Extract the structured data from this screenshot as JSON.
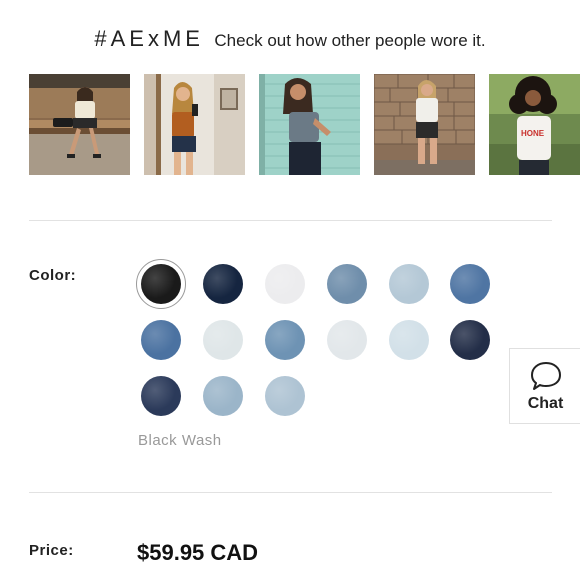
{
  "header": {
    "hashtag": "#AExME",
    "tagline": "Check out how other people wore it."
  },
  "gallery": {
    "photos": [
      {
        "name": "gallery-photo-1"
      },
      {
        "name": "gallery-photo-2"
      },
      {
        "name": "gallery-photo-3"
      },
      {
        "name": "gallery-photo-4"
      },
      {
        "name": "gallery-photo-5",
        "shirt_text": "HONE"
      }
    ]
  },
  "color_section": {
    "label": "Color:",
    "selected_name": "Black Wash",
    "selected_index": 0,
    "swatches": [
      {
        "color": "#1a1a1a"
      },
      {
        "color": "#152540"
      },
      {
        "color": "#ececee"
      },
      {
        "color": "#6f8eab"
      },
      {
        "color": "#b4c8d6"
      },
      {
        "color": "#4f75a3"
      },
      {
        "color": "#4b72a1"
      },
      {
        "color": "#dfe6e8"
      },
      {
        "color": "#6e93b4"
      },
      {
        "color": "#e2e7ea"
      },
      {
        "color": "#d2e0e8"
      },
      {
        "color": "#232e48"
      },
      {
        "color": "#2b3a5a"
      },
      {
        "color": "#9bb5c9"
      },
      {
        "color": "#aec3d3"
      }
    ]
  },
  "chat": {
    "label": "Chat",
    "icon": "chat-bubble-icon"
  },
  "price_section": {
    "label": "Price:",
    "value": "$59.95 CAD"
  }
}
